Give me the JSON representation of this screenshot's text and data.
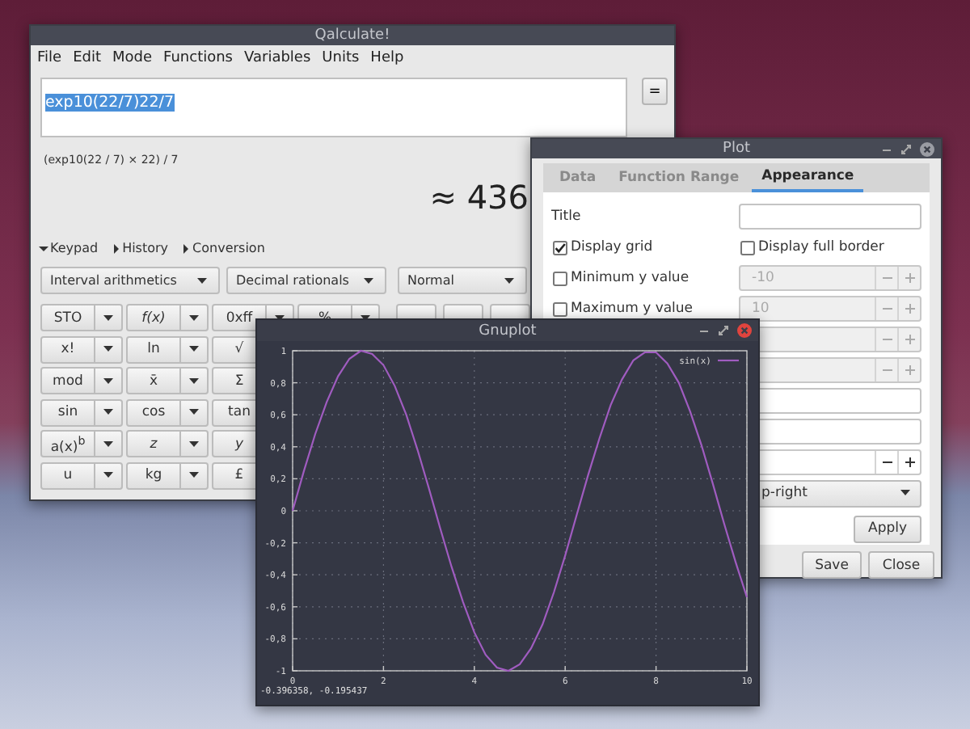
{
  "qalculate": {
    "title": "Qalculate!",
    "menu": [
      "File",
      "Edit",
      "Mode",
      "Functions",
      "Variables",
      "Units",
      "Help"
    ],
    "expression": {
      "value": "exp10(22/7)22/7",
      "selected": true
    },
    "equals_button": "=",
    "parsed": "(exp10(22 / 7) × 22) / 7",
    "result": "≈ 436",
    "panels": [
      {
        "label": "Keypad",
        "expanded": true
      },
      {
        "label": "History",
        "expanded": false
      },
      {
        "label": "Conversion",
        "expanded": false
      }
    ],
    "mode_selects": [
      "Interval arithmetics",
      "Decimal rationals",
      "Normal"
    ],
    "keypad": [
      [
        {
          "label": "STO",
          "kind": "split",
          "italic": false
        },
        {
          "label": "f(x)",
          "kind": "split",
          "italic": true
        },
        {
          "label": "0xff",
          "kind": "split",
          "italic": false
        },
        {
          "label": "%",
          "kind": "split",
          "italic": false
        },
        {
          "kind": "blank"
        },
        {
          "kind": "blank"
        },
        {
          "kind": "blank"
        }
      ],
      [
        {
          "label": "x!",
          "kind": "split",
          "italic": false
        },
        {
          "label": "ln",
          "kind": "split",
          "italic": false
        },
        {
          "label": "√",
          "kind": "plain"
        }
      ],
      [
        {
          "label": "mod",
          "kind": "split",
          "italic": false
        },
        {
          "label": "x̄",
          "kind": "split",
          "italic": false
        },
        {
          "label": "Σ",
          "kind": "plain",
          "italic": false
        }
      ],
      [
        {
          "label": "sin",
          "kind": "split",
          "italic": false
        },
        {
          "label": "cos",
          "kind": "split",
          "italic": false
        },
        {
          "label": "tan",
          "kind": "plain",
          "italic": false
        }
      ],
      [
        {
          "label": "a(x)$^{b}$",
          "kind": "split",
          "italic": false
        },
        {
          "label": "z",
          "kind": "split",
          "italic": true
        },
        {
          "label": "y",
          "kind": "plain",
          "italic": true
        }
      ],
      [
        {
          "label": "u",
          "kind": "split",
          "italic": false
        },
        {
          "label": "kg",
          "kind": "split",
          "italic": false
        },
        {
          "label": "£",
          "kind": "plain",
          "italic": false
        }
      ]
    ]
  },
  "plot": {
    "title": "Plot",
    "active": false,
    "tabs": [
      {
        "label": "Data",
        "selected": false
      },
      {
        "label": "Function Range",
        "selected": false
      },
      {
        "label": "Appearance",
        "selected": true
      }
    ],
    "title_label": "Title",
    "options": [
      {
        "label": "Display grid",
        "checked": true
      },
      {
        "label": "Display full border",
        "checked": false
      }
    ],
    "y_limits": [
      {
        "label": "Minimum y value",
        "checked": false,
        "value": "-10"
      },
      {
        "label": "Maximum y value",
        "checked": false,
        "value": "10"
      }
    ],
    "more_rows": [
      {
        "kind": "spin",
        "disabled": true
      },
      {
        "kind": "spin",
        "disabled": true
      },
      {
        "kind": "text"
      },
      {
        "kind": "text"
      },
      {
        "kind": "spin",
        "disabled": false
      },
      {
        "kind": "select",
        "value": "p-right"
      }
    ],
    "apply_button": "Apply",
    "buttons": [
      "Save",
      "Close"
    ]
  },
  "gnuplot": {
    "title": "Gnuplot",
    "active": true,
    "status": "-0.396358, -0.195437",
    "chart_data": {
      "type": "line",
      "x": [
        0,
        0.25,
        0.5,
        0.75,
        1,
        1.25,
        1.5,
        1.75,
        2,
        2.25,
        2.5,
        2.75,
        3,
        3.25,
        3.5,
        3.75,
        4,
        4.25,
        4.5,
        4.75,
        5,
        5.25,
        5.5,
        5.75,
        6,
        6.25,
        6.5,
        6.75,
        7,
        7.25,
        7.5,
        7.75,
        8,
        8.25,
        8.5,
        8.75,
        9,
        9.25,
        9.5,
        9.75,
        10
      ],
      "series": [
        {
          "name": "sin(x)",
          "color": "#a05cc0",
          "values": [
            0,
            0.25,
            0.48,
            0.68,
            0.84,
            0.95,
            1,
            0.98,
            0.91,
            0.78,
            0.6,
            0.38,
            0.14,
            -0.11,
            -0.35,
            -0.57,
            -0.76,
            -0.9,
            -0.98,
            -1,
            -0.96,
            -0.86,
            -0.71,
            -0.51,
            -0.28,
            -0.03,
            0.22,
            0.45,
            0.66,
            0.82,
            0.94,
            0.99,
            0.99,
            0.92,
            0.8,
            0.62,
            0.41,
            0.17,
            -0.08,
            -0.32,
            -0.54
          ]
        }
      ],
      "grid": true,
      "xlim": [
        0,
        10
      ],
      "ylim": [
        -1,
        1
      ],
      "xticks": [
        0,
        2,
        4,
        6,
        8,
        10
      ],
      "yticks": [
        -1,
        {
          "value": -0.8,
          "label": "-0,8"
        },
        {
          "value": -0.6,
          "label": "-0,6"
        },
        {
          "value": -0.4,
          "label": "-0,4"
        },
        {
          "value": -0.2,
          "label": "-0,2"
        },
        0,
        {
          "value": 0.2,
          "label": "0,2"
        },
        {
          "value": 0.4,
          "label": "0,4"
        },
        {
          "value": 0.6,
          "label": "0,6"
        },
        {
          "value": 0.8,
          "label": "0,8"
        },
        1
      ]
    }
  }
}
